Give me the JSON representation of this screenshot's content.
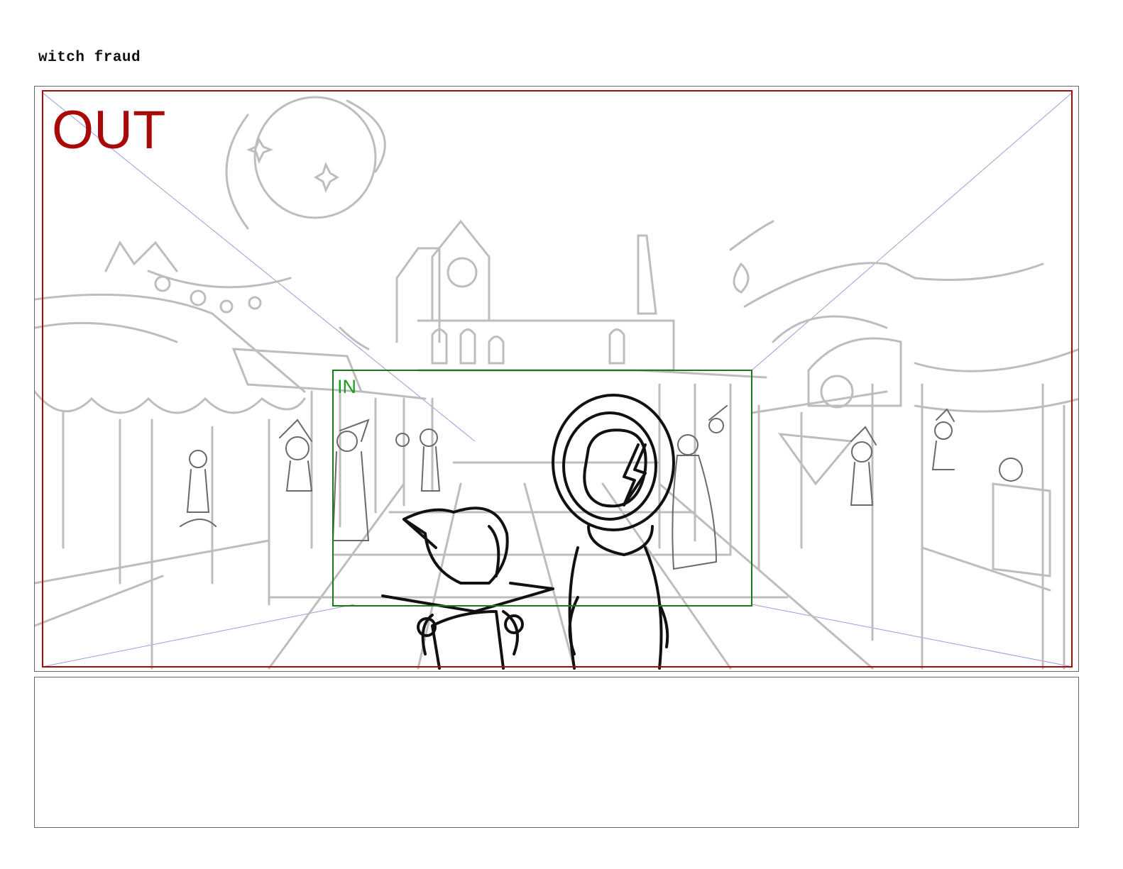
{
  "document": {
    "title": "witch fraud"
  },
  "panel": {
    "frame_out_label": "OUT",
    "frame_in_label": "IN",
    "colors": {
      "frame_out": "#a80a0a",
      "frame_in": "#1a7a1a",
      "frame_in_label": "#1aa01a",
      "perspective_guides": "#9a9ae0",
      "background_sketch": "#bdbdbd",
      "character_lines": "#111111"
    }
  },
  "notes": {
    "text": ""
  }
}
